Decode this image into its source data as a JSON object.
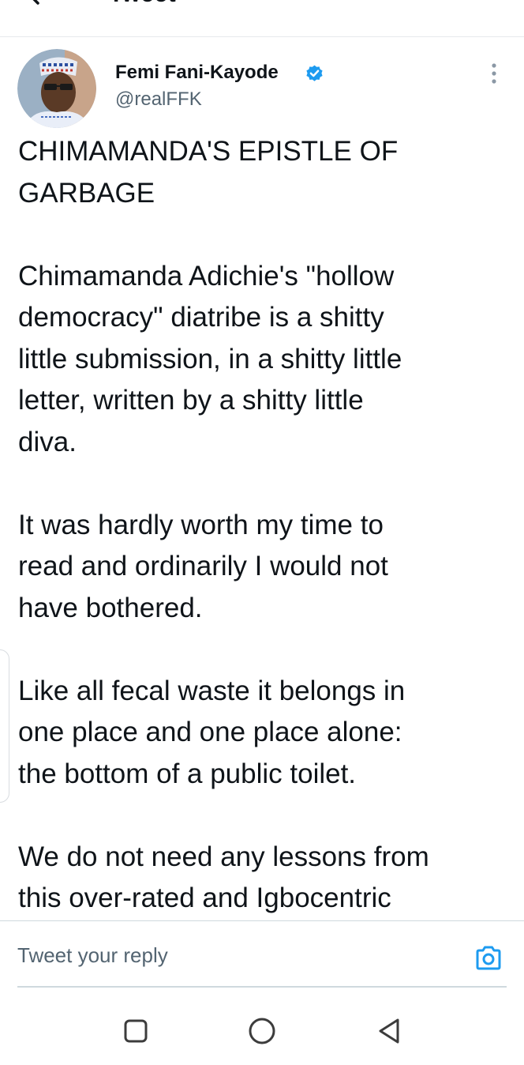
{
  "header": {
    "title": "Tweet"
  },
  "author": {
    "name": "Femi Fani-Kayode",
    "handle": "@realFFK",
    "verified": true
  },
  "tweet": {
    "paragraphs": [
      "CHIMAMANDA'S EPISTLE OF\nGARBAGE",
      "Chimamanda Adichie's \"hollow\ndemocracy\" diatribe is a shitty\nlittle submission, in a shitty little\nletter, written by a shitty little\ndiva.",
      "It was hardly worth my time to\nread and ordinarily I would not\nhave bothered.",
      "Like all fecal waste it belongs in\none place and one place alone:\nthe bottom of a public toilet.",
      "We do not need any lessons from\nthis over-rated and Igbocentric"
    ]
  },
  "reply": {
    "placeholder": "Tweet your reply"
  },
  "icons": {
    "back": "back-arrow-icon",
    "verified": "verified-badge-icon",
    "more": "more-vertical-icon",
    "camera": "camera-icon",
    "recents": "nav-recents-icon",
    "home": "nav-home-icon",
    "nav_back": "nav-back-icon"
  },
  "colors": {
    "accent": "#1d9bf0",
    "text": "#0f1419",
    "secondary_text": "#536471",
    "divider": "#cfd9de"
  }
}
